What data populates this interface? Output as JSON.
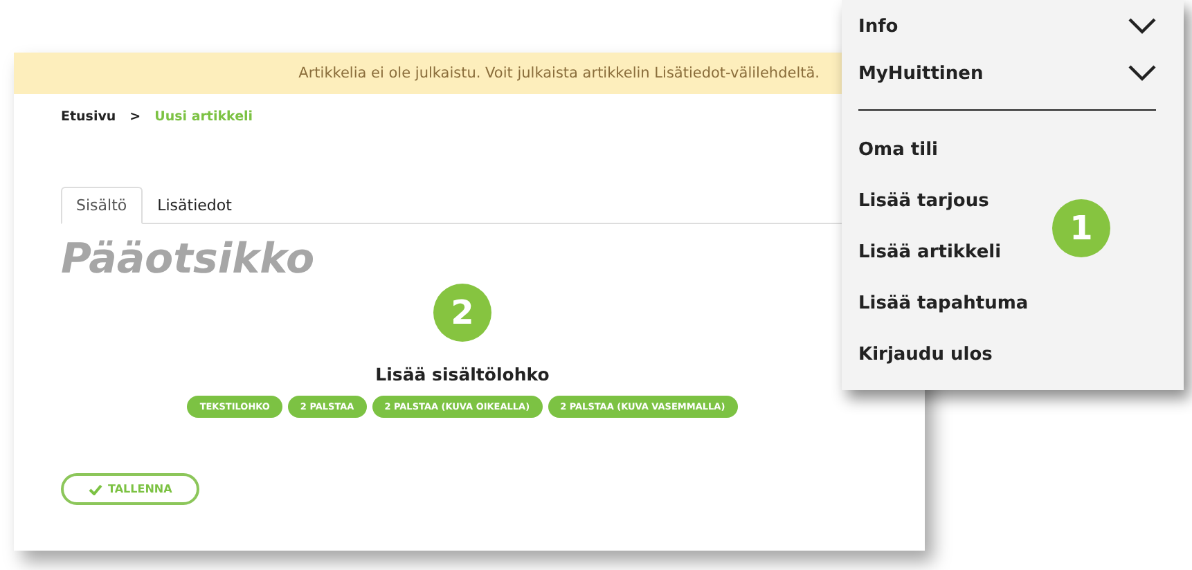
{
  "notice": "Artikkelia ei ole julkaistu. Voit julkaista artikkelin Lisätiedot-välilehdeltä.",
  "breadcrumb": [
    {
      "label": "Etusivu",
      "current": false
    },
    {
      "label": "Uusi artikkeli",
      "current": true
    }
  ],
  "breadcrumb_separator": ">",
  "tabs": [
    {
      "label": "Sisältö",
      "selected": true
    },
    {
      "label": "Lisätiedot",
      "selected": false
    }
  ],
  "title_placeholder": "Pääotsikko",
  "callouts": [
    "1",
    "2"
  ],
  "block_heading": "Lisää sisältölohko",
  "block_buttons": [
    "TEKSTILOHKO",
    "2 PALSTAA",
    "2 PALSTAA (KUVA OIKEALLA)",
    "2 PALSTAA (KUVA VASEMMALLA)"
  ],
  "save_button": "TALLENNA",
  "menu": {
    "sections": [
      {
        "label": "Info",
        "expanded": false
      },
      {
        "label": "MyHuittinen",
        "expanded": false
      }
    ],
    "items": [
      "Oma tili",
      "Lisää tarjous",
      "Lisää artikkeli",
      "Lisää tapahtuma",
      "Kirjaudu ulos"
    ]
  }
}
